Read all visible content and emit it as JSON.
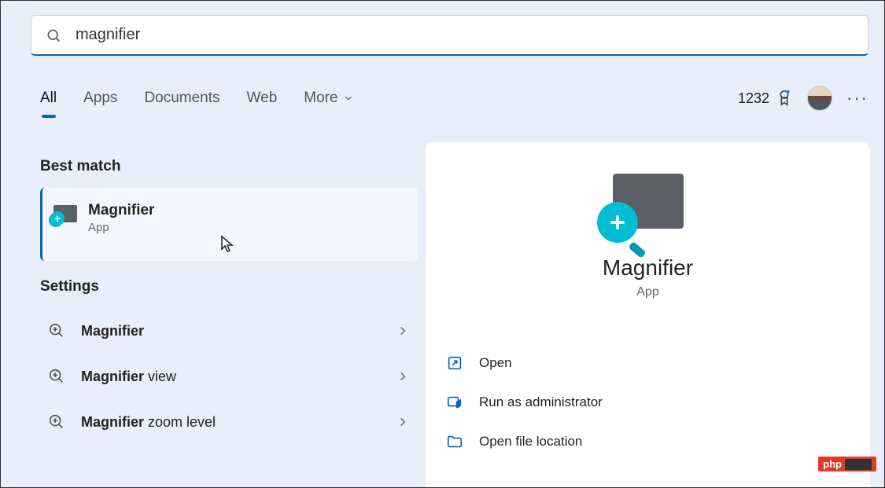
{
  "search": {
    "value": "magnifier"
  },
  "tabs": {
    "all": "All",
    "apps": "Apps",
    "documents": "Documents",
    "web": "Web",
    "more": "More"
  },
  "points": "1232",
  "sections": {
    "best_match": "Best match",
    "settings": "Settings"
  },
  "best": {
    "title": "Magnifier",
    "subtitle": "App"
  },
  "settings_items": [
    {
      "bold": "Magnifier",
      "rest": ""
    },
    {
      "bold": "Magnifier",
      "rest": " view"
    },
    {
      "bold": "Magnifier",
      "rest": " zoom level"
    }
  ],
  "hero": {
    "title": "Magnifier",
    "subtitle": "App"
  },
  "actions": {
    "open": "Open",
    "run_admin": "Run as administrator",
    "open_loc": "Open file location"
  },
  "watermark": "php"
}
